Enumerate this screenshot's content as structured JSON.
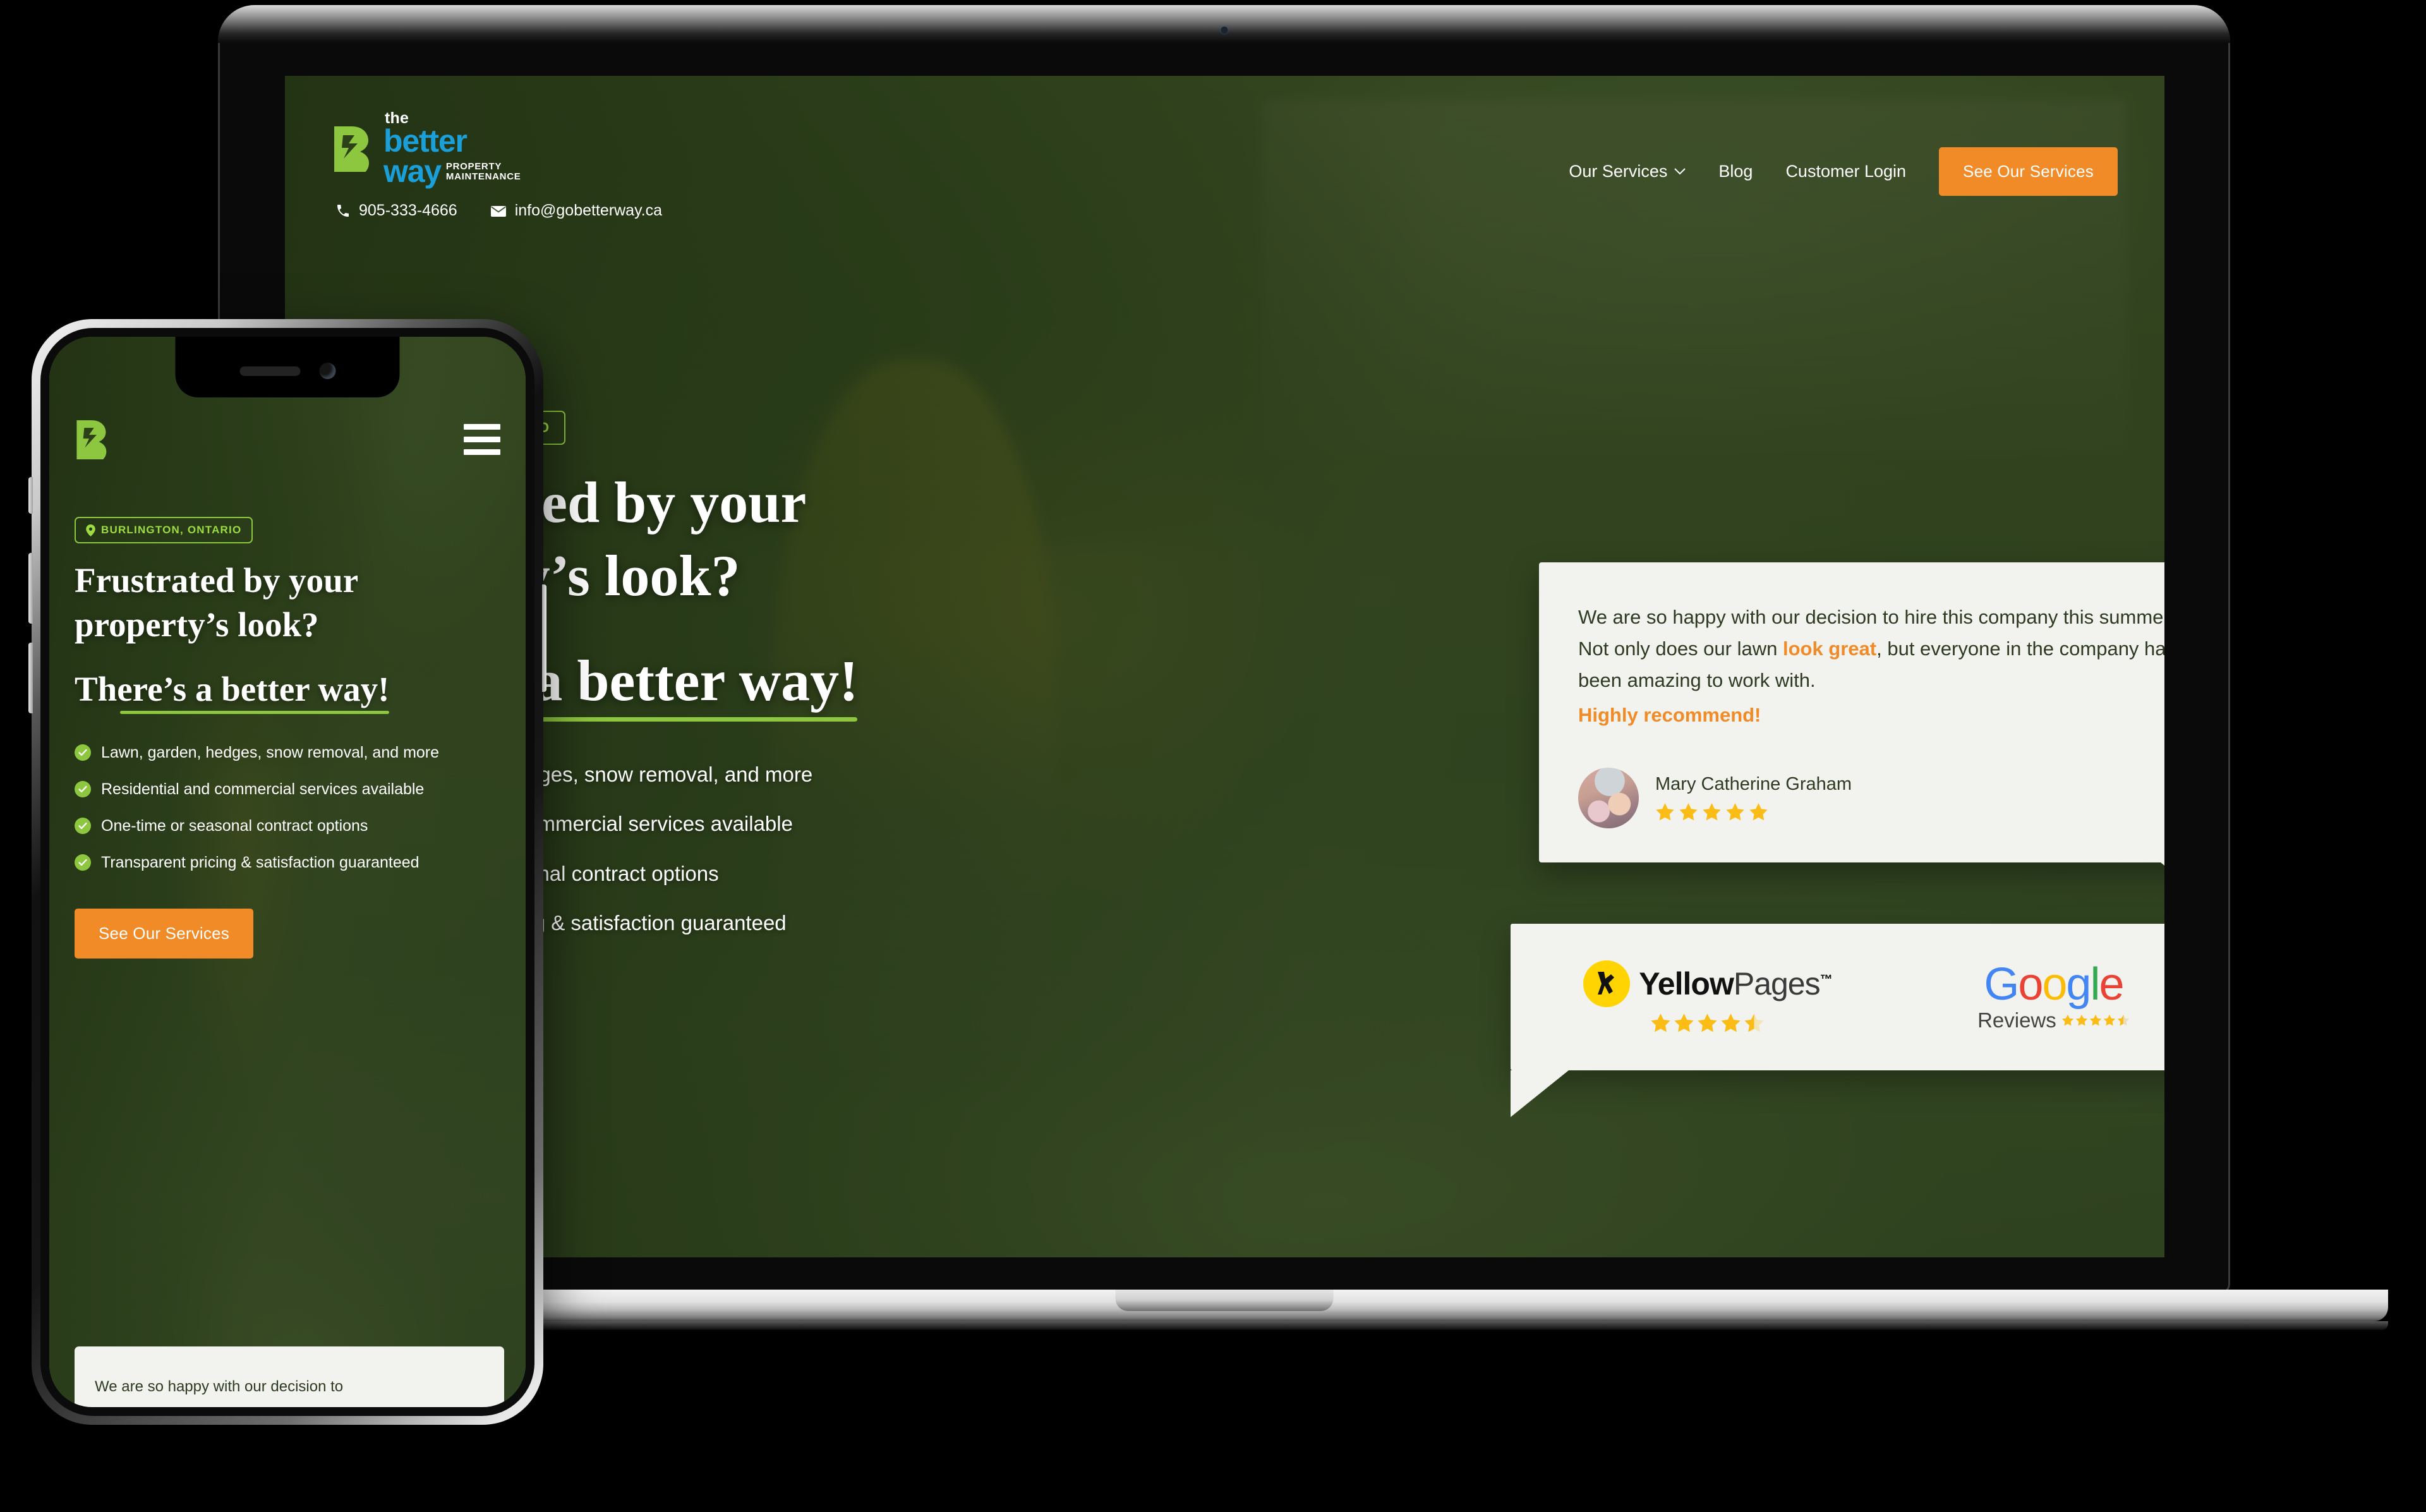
{
  "brand": {
    "logo_the": "the",
    "logo_better": "better",
    "logo_way": "way",
    "logo_sub_line1": "PROPERTY",
    "logo_sub_line2": "MAINTENANCE",
    "logo_icon": "better-way-b-mark"
  },
  "contact": {
    "phone": "905-333-4666",
    "email": "info@gobetterway.ca",
    "phone_icon": "phone-icon",
    "email_icon": "envelope-icon"
  },
  "nav": {
    "items": [
      {
        "label": "Our Services",
        "has_caret": true
      },
      {
        "label": "Blog",
        "has_caret": false
      },
      {
        "label": "Customer Login",
        "has_caret": false
      }
    ],
    "cta_label": "See Our Services"
  },
  "hero": {
    "location_badge": "BURLINGTON, ONTARIO",
    "location_icon": "map-pin-icon",
    "headline_line1": "Frustrated by your",
    "headline_line2": "property’s look?",
    "headline_line3": "There’s a better way!",
    "bullets": [
      "Lawn, garden, hedges, snow removal, and more",
      "Residential and commercial services available",
      "One-time or seasonal contract options",
      "Transparent pricing & satisfaction guaranteed"
    ],
    "cta_label": "See Our Services"
  },
  "hero_mobile": {
    "bullets": [
      "Lawn, garden, hedges, snow removal, and more",
      "Residential and commercial services available",
      "One-time or seasonal contract options",
      "Transparent pricing & satisfaction guaranteed"
    ]
  },
  "testimonial": {
    "text_part1": "We are so happy with our decision to hire this company this summer. Not only does our lawn ",
    "highlight1": "look great",
    "text_part2": ", but everyone in the company has been amazing to work with. ",
    "recommend": "Highly recommend!",
    "author": "Mary Catherine Graham",
    "rating": 5,
    "avatar_alt": "reviewer-photo"
  },
  "testimonial_mobile": {
    "text": "We are so happy with our decision to"
  },
  "badges": {
    "yellowpages": {
      "word_yellow": "Yellow",
      "word_pages": "Pages",
      "trademark": "™",
      "rating": 4.5
    },
    "google": {
      "letters": [
        "G",
        "o",
        "o",
        "g",
        "l",
        "e"
      ],
      "reviews_label": "Reviews",
      "rating": 4.5
    }
  },
  "colors": {
    "orange": "#f08b28",
    "green": "#8dc63f",
    "blue": "#1a9fd9",
    "star_gold": "#fbbc15",
    "card_bg": "#f2f2ef",
    "hero_green": "#3d5430"
  }
}
